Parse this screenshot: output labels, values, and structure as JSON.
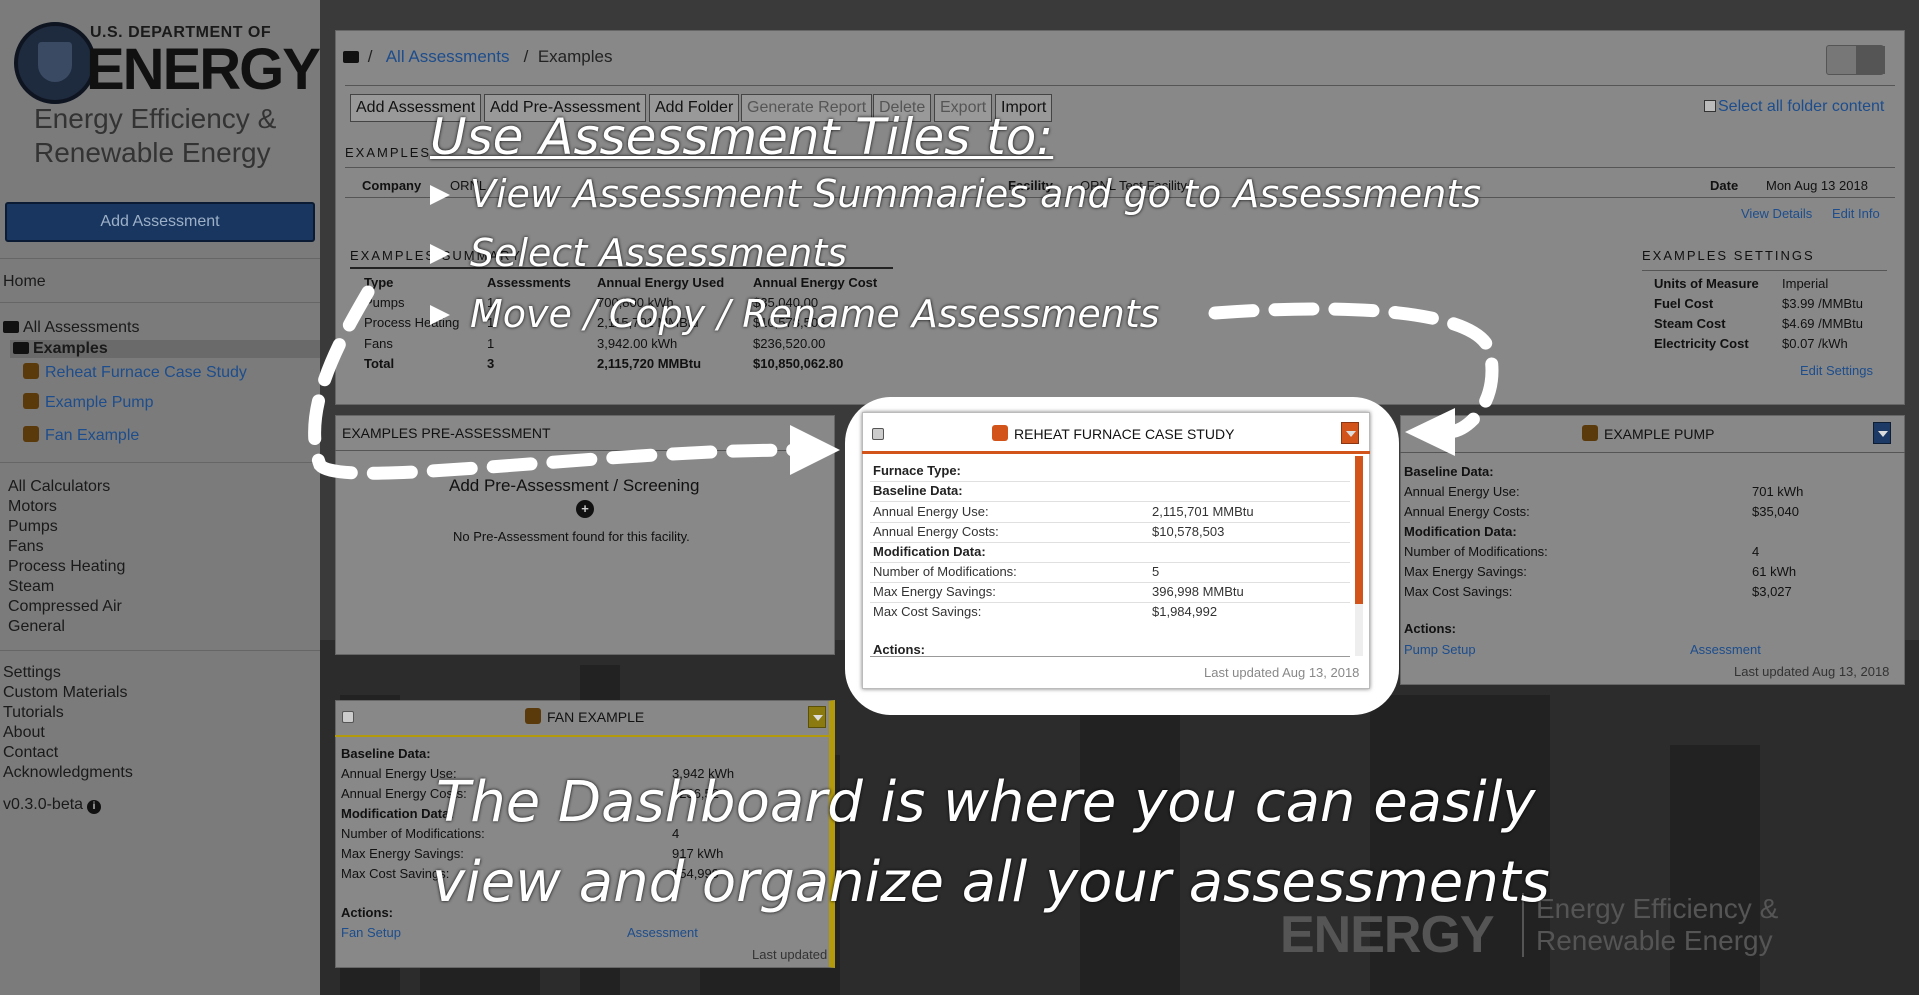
{
  "sidebar": {
    "logo": {
      "usdoe": "U.S. DEPARTMENT OF",
      "energy": "ENERGY",
      "eere": "Energy Efficiency & Renewable Energy"
    },
    "add_assessment": "Add Assessment",
    "home": "Home",
    "all_assessments": "All Assessments",
    "examples": "Examples",
    "tree": [
      "Reheat Furnace Case Study",
      "Example Pump",
      "Fan Example"
    ],
    "calculators": [
      "All Calculators",
      "Motors",
      "Pumps",
      "Fans",
      "Process Heating",
      "Steam",
      "Compressed Air",
      "General"
    ],
    "bottom": [
      "Settings",
      "Custom Materials",
      "Tutorials",
      "About",
      "Contact",
      "Acknowledgments"
    ],
    "version": "v0.3.0-beta"
  },
  "breadcrumb": {
    "all": "All Assessments",
    "sep": "/",
    "current": "Examples"
  },
  "toolbar": {
    "buttons": [
      "Add Assessment",
      "Add Pre-Assessment",
      "Add Folder",
      "Generate Report",
      "Delete",
      "Export",
      "Import"
    ],
    "select_all": "Select all folder content"
  },
  "folder_info": {
    "label": "EXAMPLES",
    "company_label": "Company",
    "company_value": "ORNL",
    "facility_label": "Facility",
    "facility_value": "ORNL Test Facility",
    "date_label": "Date",
    "date_value": "Mon Aug 13 2018",
    "view_details": "View Details",
    "edit_info": "Edit Info"
  },
  "summary": {
    "label": "EXAMPLES SUMMARY",
    "headers": [
      "Type",
      "Assessments",
      "Annual Energy Used",
      "Annual Energy Cost"
    ],
    "rows": [
      [
        "Pumps",
        "1",
        "700,800 kWh",
        "$35,040.00"
      ],
      [
        "Process Heating",
        "1",
        "2,115,701 MMBtu",
        "$10,578,503"
      ],
      [
        "Fans",
        "1",
        "3,942.00 kWh",
        "$236,520.00"
      ],
      [
        "Total",
        "3",
        "2,115,720 MMBtu",
        "$10,850,062.80"
      ]
    ]
  },
  "settings": {
    "label": "EXAMPLES SETTINGS",
    "rows": [
      [
        "Units of Measure",
        "Imperial"
      ],
      [
        "Fuel Cost",
        "$3.99 /MMBtu"
      ],
      [
        "Steam Cost",
        "$4.69 /MMBtu"
      ],
      [
        "Electricity Cost",
        "$0.07 /kWh"
      ]
    ],
    "edit": "Edit Settings"
  },
  "pre_assessment": {
    "title": "EXAMPLES PRE-ASSESSMENT",
    "add": "Add Pre-Assessment / Screening",
    "plus": "+",
    "empty": "No Pre-Assessment found for this facility."
  },
  "furnace_tile": {
    "title": "REHEAT FURNACE CASE STUDY",
    "furnace_type": "Furnace Type:",
    "baseline": "Baseline Data:",
    "rows1": [
      [
        "Annual Energy Use:",
        "2,115,701 MMBtu"
      ],
      [
        "Annual Energy Costs:",
        "$10,578,503"
      ]
    ],
    "modification": "Modification Data:",
    "rows2": [
      [
        "Number of Modifications:",
        "5"
      ],
      [
        "Max Energy Savings:",
        "396,998 MMBtu"
      ],
      [
        "Max Cost Savings:",
        "$1,984,992"
      ]
    ],
    "actions": "Actions:",
    "updated": "Last updated Aug 13, 2018"
  },
  "pump_tile": {
    "title": "EXAMPLE PUMP",
    "baseline": "Baseline Data:",
    "rows1": [
      [
        "Annual Energy Use:",
        "701 kWh"
      ],
      [
        "Annual Energy Costs:",
        "$35,040"
      ]
    ],
    "modification": "Modification Data:",
    "rows2": [
      [
        "Number of Modifications:",
        "4"
      ],
      [
        "Max Energy Savings:",
        "61 kWh"
      ],
      [
        "Max Cost Savings:",
        "$3,027"
      ]
    ],
    "actions": "Actions:",
    "links": [
      "Pump Setup",
      "Assessment"
    ],
    "updated": "Last updated Aug 13, 2018"
  },
  "fan_tile": {
    "title": "FAN EXAMPLE",
    "baseline": "Baseline Data:",
    "rows1": [
      [
        "Annual Energy Use:",
        "3,942 kWh"
      ],
      [
        "Annual Energy Costs:",
        "$236,52"
      ]
    ],
    "modification": "Modification Data:",
    "rows2": [
      [
        "Number of Modifications:",
        "4"
      ],
      [
        "Max Energy Savings:",
        "917 kWh"
      ],
      [
        "Max Cost Savings:",
        "$54,999"
      ]
    ],
    "actions": "Actions:",
    "links": [
      "Fan Setup",
      "Assessment"
    ],
    "updated": "Last updated"
  },
  "background_logo": {
    "energy": "ENERGY",
    "eere": "Energy Efficiency & Renewable Energy"
  },
  "overlay": {
    "title": "Use Assessment Tiles to:",
    "bullets": [
      "View Assessment Summaries and go to Assessments",
      "Select Assessments",
      "Move / Copy / Rename Assessments"
    ],
    "bottom1": "The Dashboard is where you can easily",
    "bottom2": "view and organize all your assessments"
  },
  "colors": {
    "accent_orange": "#d2541a",
    "link_blue": "#1d4d8c",
    "overlay_text": "#ffffff"
  }
}
